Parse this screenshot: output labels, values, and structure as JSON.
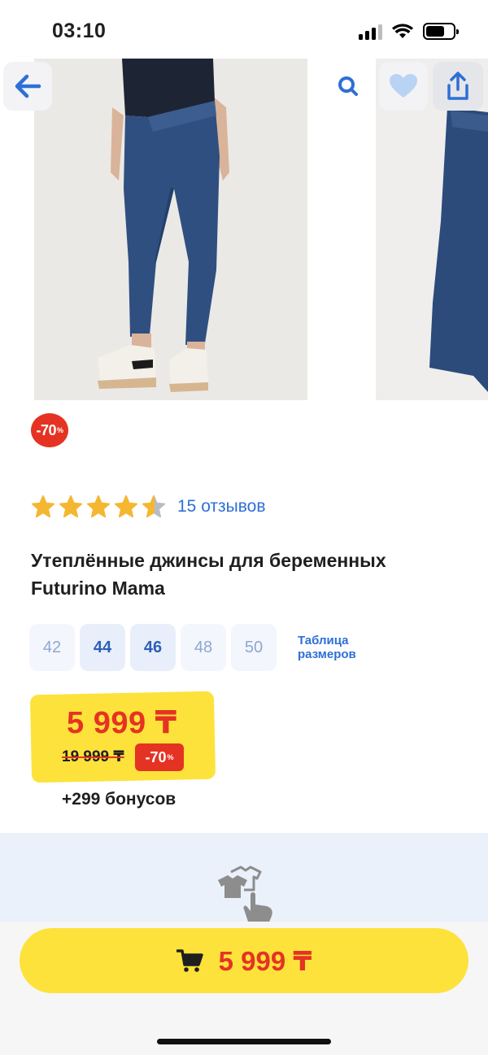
{
  "status_bar": {
    "time": "03:10"
  },
  "gallery": {
    "icons": {
      "back": "arrow-left-icon",
      "search": "search-icon",
      "favorite": "heart-icon",
      "share": "share-icon"
    }
  },
  "discount_badge": {
    "value": "-70",
    "unit": "%"
  },
  "rating": {
    "stars": 4.5,
    "max": 5,
    "reviews_label": "15 отзывов"
  },
  "product": {
    "title": "Утеплённые джинсы для беременных Futurino Mama"
  },
  "sizes": {
    "items": [
      {
        "label": "42",
        "available": false
      },
      {
        "label": "44",
        "available": true
      },
      {
        "label": "46",
        "available": true
      },
      {
        "label": "48",
        "available": false
      },
      {
        "label": "50",
        "available": false
      }
    ],
    "table_link": "Таблица размеров"
  },
  "price": {
    "current": "5 999 ₸",
    "old": "19 999 ₸",
    "discount": "-70",
    "discount_unit": "%",
    "bonus": "+299 бонусов"
  },
  "buy_button": {
    "icon": "cart-icon",
    "price": "5 999 ₸"
  },
  "colors": {
    "accent_yellow": "#fde23b",
    "accent_red": "#e53323",
    "link_blue": "#2e6fd6",
    "star_gold": "#f5b731"
  }
}
